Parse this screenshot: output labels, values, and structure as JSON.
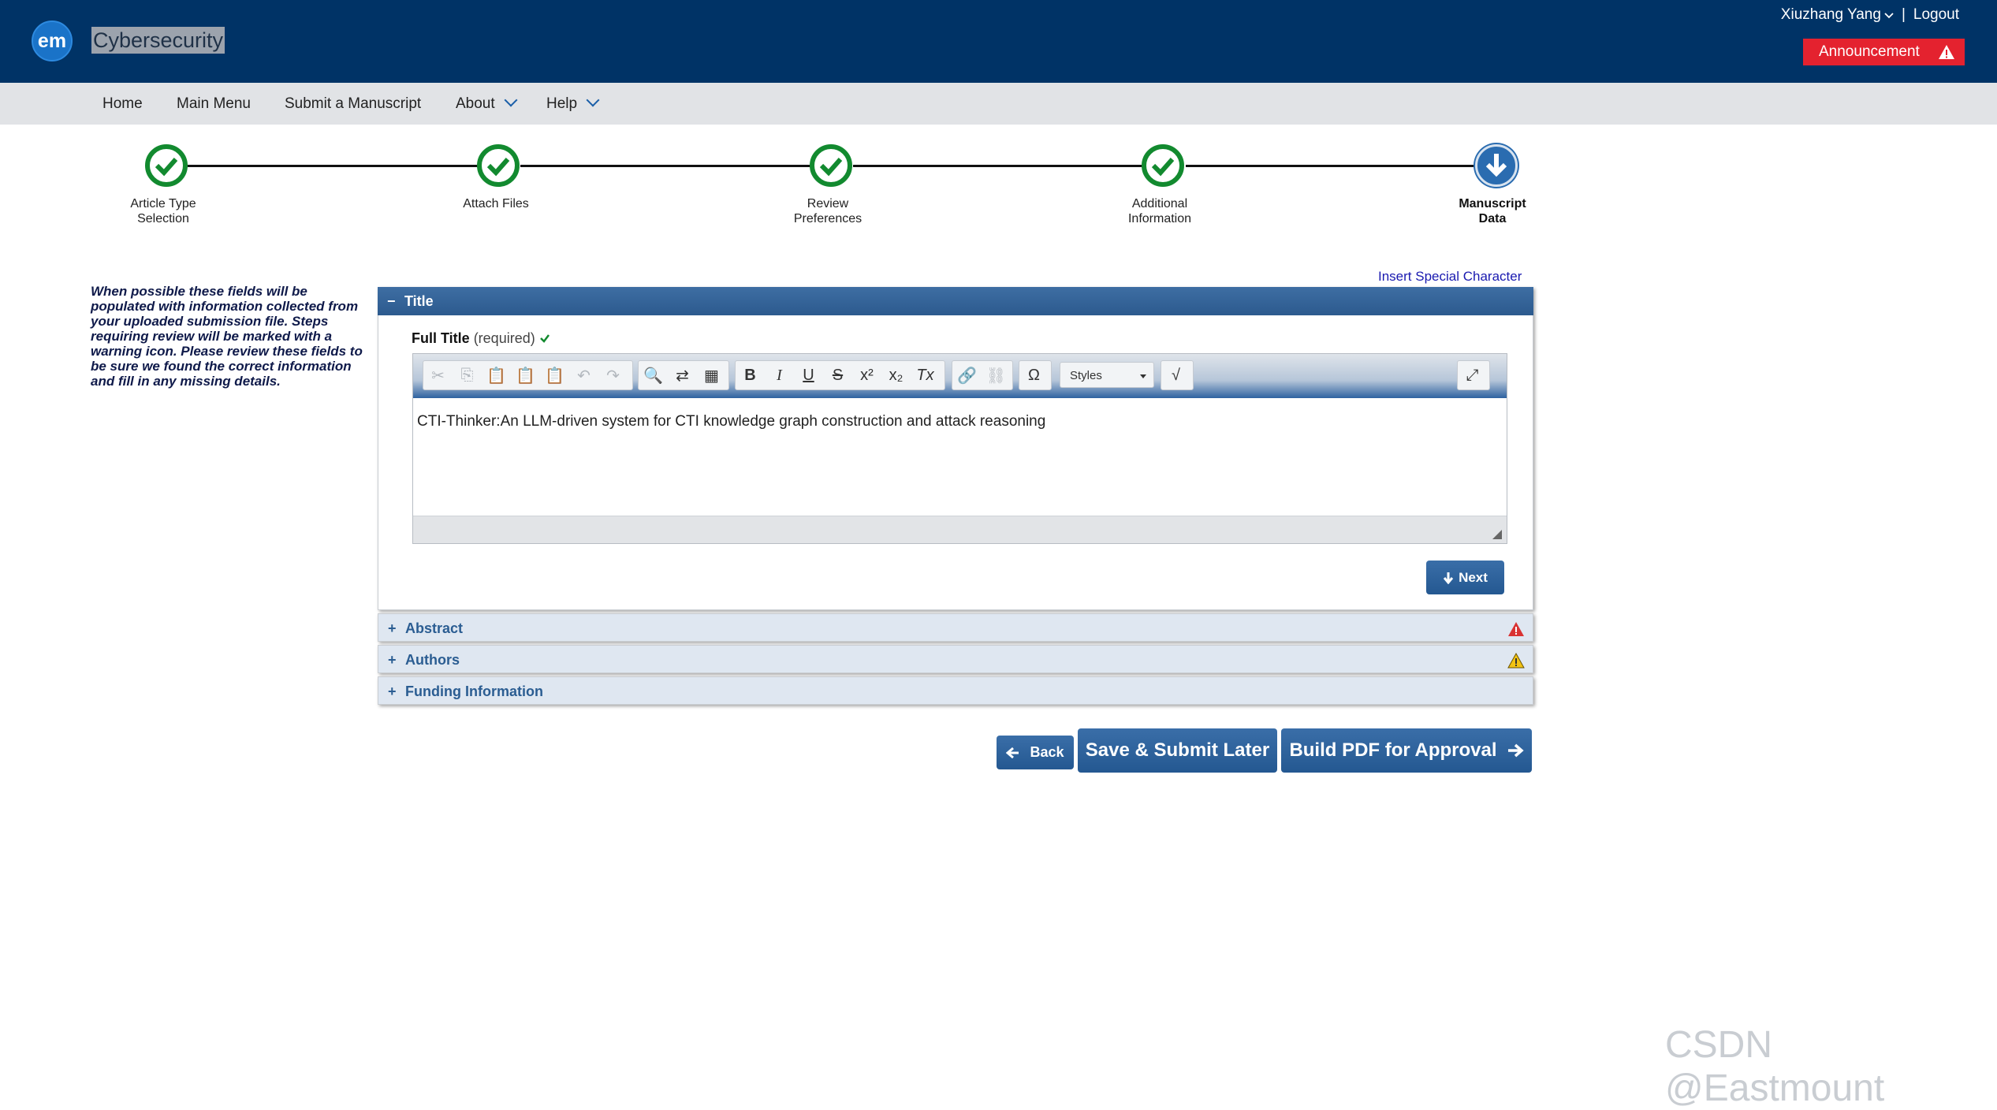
{
  "header": {
    "logo_text": "em",
    "journal_name": "Cybersecurity",
    "user_name": "Xiuzhang Yang",
    "separator": "|",
    "logout_label": "Logout",
    "announcement_label": "Announcement"
  },
  "nav": {
    "items": [
      {
        "label": "Home"
      },
      {
        "label": "Main Menu"
      },
      {
        "label": "Submit a Manuscript"
      },
      {
        "label": "About"
      },
      {
        "label": "Help"
      }
    ]
  },
  "steps": [
    {
      "line1": "Article Type",
      "line2": "Selection",
      "status": "complete"
    },
    {
      "line1": "Attach Files",
      "line2": "",
      "status": "complete"
    },
    {
      "line1": "Review",
      "line2": "Preferences",
      "status": "complete"
    },
    {
      "line1": "Additional",
      "line2": "Information",
      "status": "complete"
    },
    {
      "line1": "Manuscript",
      "line2": "Data",
      "status": "current"
    }
  ],
  "side_note": "When possible these fields will be populated with information collected from your uploaded submission file. Steps requiring review will be marked with a warning icon. Please review these fields to be sure we found the correct information and fill in any missing details.",
  "insert_special_label": "Insert Special Character",
  "panels": {
    "title": {
      "label": "Title",
      "expanded": true
    },
    "abstract": {
      "label": "Abstract",
      "warning": "error-icon"
    },
    "authors": {
      "label": "Authors",
      "warning": "warning-icon"
    },
    "funding": {
      "label": "Funding Information"
    }
  },
  "title_form": {
    "field_label": "Full Title",
    "required_label": "(required)",
    "styles_label": "Styles",
    "value": "CTI-Thinker:An LLM-driven system for CTI knowledge graph construction and attack reasoning"
  },
  "buttons": {
    "next": "Next",
    "back": "Back",
    "save_later": "Save & Submit Later",
    "build_pdf": "Build PDF for Approval"
  },
  "watermark": "CSDN @Eastmount",
  "colors": {
    "header_bg": "#003366",
    "nav_bg": "#e1e3e6",
    "step_complete": "#128a2f",
    "step_current": "#2a6cb0",
    "button_blue": "#2c5f98",
    "announcement_red": "#e4222f"
  }
}
